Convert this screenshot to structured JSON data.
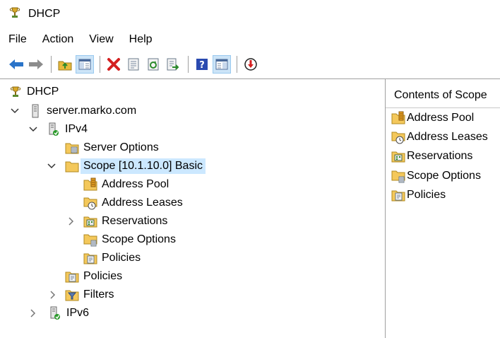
{
  "window": {
    "title": "DHCP"
  },
  "menu": [
    "File",
    "Action",
    "View",
    "Help"
  ],
  "toolbar": {
    "buttons": [
      "back-arrow-icon",
      "forward-arrow-icon",
      "up-folder-icon",
      "show-hide-tree-icon",
      "delete-icon",
      "properties-icon",
      "refresh-icon",
      "export-list-icon",
      "help-icon",
      "show-action-pane-icon",
      "deactivate-icon"
    ]
  },
  "tree": {
    "root": "DHCP",
    "server": "server.marko.com",
    "ipv4": "IPv4",
    "server_options": "Server Options",
    "scope": "Scope [10.1.10.0] Basic",
    "address_pool": "Address Pool",
    "address_leases": "Address Leases",
    "reservations": "Reservations",
    "scope_options": "Scope Options",
    "scope_policies": "Policies",
    "ipv4_policies": "Policies",
    "filters": "Filters",
    "ipv6": "IPv6"
  },
  "contents": {
    "header": "Contents of Scope",
    "items": [
      "Address Pool",
      "Address Leases",
      "Reservations",
      "Scope Options",
      "Policies"
    ]
  },
  "colors": {
    "selection": "#cce8ff",
    "folder": "#f4c85b",
    "accent_blue": "#2a74c9",
    "delete_red": "#d42020"
  }
}
